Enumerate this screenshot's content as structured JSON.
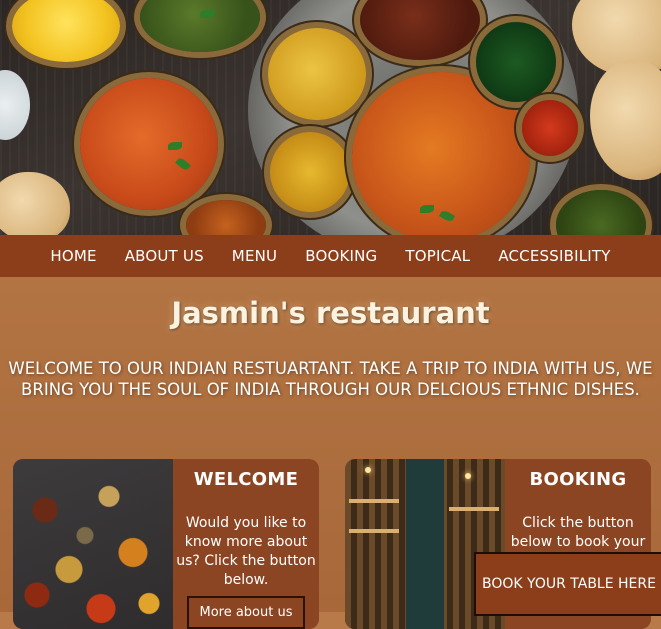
{
  "nav": {
    "items": [
      "HOME",
      "ABOUT US",
      "MENU",
      "BOOKING",
      "TOPICAL",
      "ACCESSIBILITY"
    ]
  },
  "header": {
    "title": "Jasmin's restaurant",
    "welcome": "WELCOME TO OUR INDIAN RESTUARTANT. TAKE A TRIP TO INDIA WITH US, WE BRING YOU THE SOUL OF INDIA THROUGH OUR DELCIOUS ETHNIC DISHES."
  },
  "cards": {
    "welcome": {
      "title": "WELCOME",
      "text": "Would you like to know more about us? Click the button below.",
      "button": "More about us"
    },
    "booking": {
      "title": "BOOKING",
      "text": "Click the button below to book your"
    }
  },
  "floating_button": "BOOK YOUR TABLE HERE",
  "colors": {
    "nav_bg": "#8c3d1a",
    "card_bg": "#8c4523",
    "page_bg": "#b87a49"
  }
}
